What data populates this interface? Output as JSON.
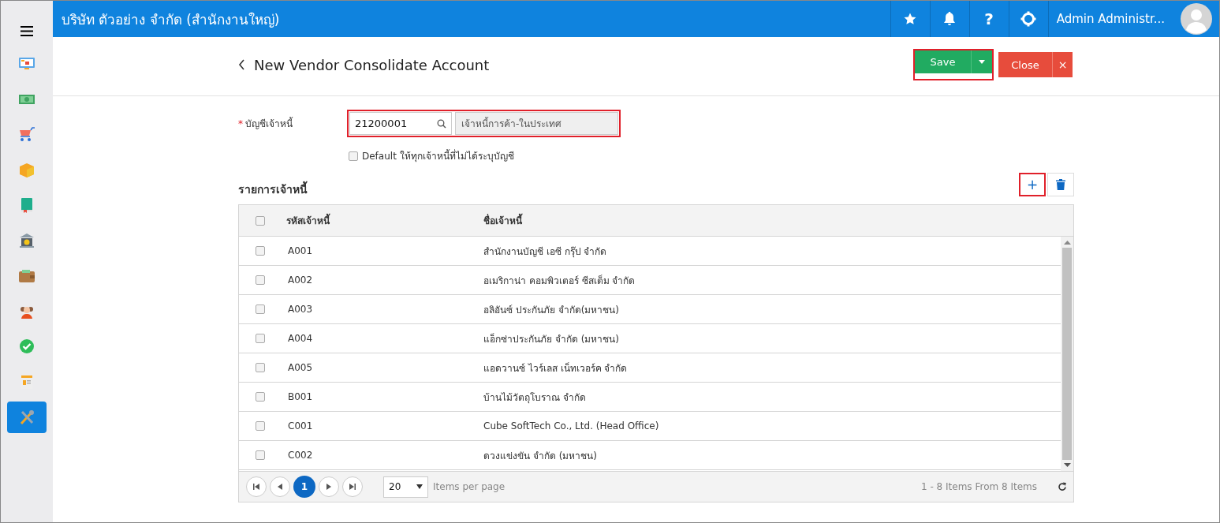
{
  "sidebar": {
    "items": [
      {
        "kind": "monitor",
        "selected": false
      },
      {
        "kind": "cash",
        "selected": false
      },
      {
        "kind": "cart",
        "selected": false
      },
      {
        "kind": "box",
        "selected": false
      },
      {
        "kind": "book",
        "selected": false
      },
      {
        "kind": "bank",
        "selected": false
      },
      {
        "kind": "wallet",
        "selected": false
      },
      {
        "kind": "people",
        "selected": false
      },
      {
        "kind": "check",
        "selected": false
      },
      {
        "kind": "invoice",
        "selected": false
      },
      {
        "kind": "tools",
        "selected": true
      }
    ]
  },
  "topbar": {
    "company": "บริษัท ตัวอย่าง จำกัด (สำนักงานใหญ่)",
    "help": "?",
    "user": "Admin Administr..."
  },
  "page": {
    "title": "New Vendor Consolidate Account",
    "save": {
      "label": "Save",
      "highlighted": true
    },
    "close": {
      "label": "Close",
      "close_mark": "×"
    }
  },
  "form": {
    "required_mark": "*",
    "label": "บัญชีเจ้าหนี้",
    "account_code": "21200001",
    "account_name": "เจ้าหนี้การค้า-ในประเทศ",
    "highlighted": true,
    "default_option": {
      "label": "Default ให้ทุกเจ้าหนี้ที่ไม่ได้ระบุบัญชี",
      "checked": false
    }
  },
  "vendor_list": {
    "title": "รายการเจ้าหนี้",
    "add": {
      "label": "+",
      "highlighted": true
    },
    "table": {
      "header_checked": false,
      "columns": [
        "รหัสเจ้าหนี้",
        "ชื่อเจ้าหนี้"
      ],
      "rows": [
        {
          "code": "A001",
          "name": "สำนักงานบัญชี เอซี กรุ๊ป จำกัด",
          "checked": false
        },
        {
          "code": "A002",
          "name": "อเมริกาน่า คอมพิวเตอร์ ซีสเต็ม จำกัด",
          "checked": false
        },
        {
          "code": "A003",
          "name": "อลิอันซ์ ประกันภัย จำกัด(มหาชน)",
          "checked": false
        },
        {
          "code": "A004",
          "name": "แอ็กซ่าประกันภัย จำกัด (มหาชน)",
          "checked": false
        },
        {
          "code": "A005",
          "name": "แอดวานซ์ ไวร์เลส เน็ทเวอร์ค จำกัด",
          "checked": false
        },
        {
          "code": "B001",
          "name": "บ้านไม้วัตถุโบราณ จำกัด",
          "checked": false
        },
        {
          "code": "C001",
          "name": "Cube SoftTech Co., Ltd. (Head Office)",
          "checked": false
        },
        {
          "code": "C002",
          "name": "ดวงแข่งขัน จำกัด (มหาชน)",
          "checked": false
        }
      ]
    },
    "pager": {
      "pages": [
        {
          "label": "1",
          "selected": true
        }
      ],
      "page_size": "20",
      "page_size_label": "Items per page",
      "summary": "1 - 8 Items From 8 Items"
    }
  }
}
